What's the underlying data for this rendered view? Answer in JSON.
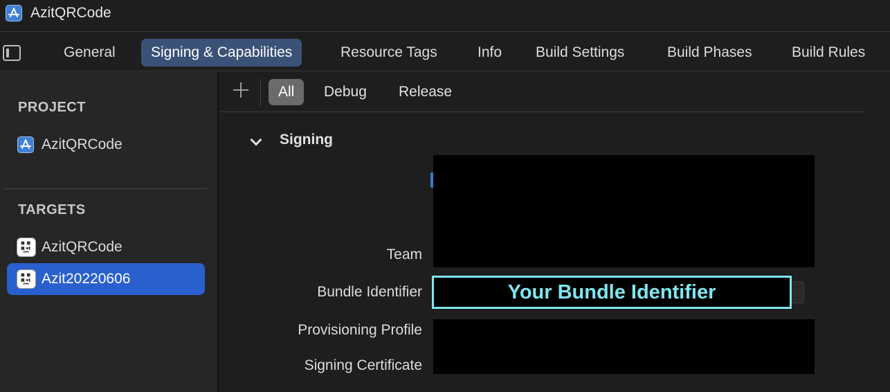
{
  "window": {
    "title": "AzitQRCode",
    "app_icon": "app-store-icon"
  },
  "tabs": [
    {
      "label": "General"
    },
    {
      "label": "Signing & Capabilities",
      "active": true
    },
    {
      "label": "Resource Tags"
    },
    {
      "label": "Info"
    },
    {
      "label": "Build Settings"
    },
    {
      "label": "Build Phases"
    },
    {
      "label": "Build Rules"
    }
  ],
  "sidebar": {
    "project_header": "PROJECT",
    "project_item": "AzitQRCode",
    "targets_header": "TARGETS",
    "targets": [
      {
        "label": "AzitQRCode",
        "selected": false
      },
      {
        "label": "Azit20220606",
        "selected": true
      }
    ]
  },
  "filters": {
    "all": "All",
    "debug": "Debug",
    "release": "Release",
    "active": "All"
  },
  "signing": {
    "section_label": "Signing",
    "team_label": "Team",
    "bundle_label": "Bundle Identifier",
    "bundle_value": "Your Bundle Identifier",
    "profile_label": "Provisioning Profile",
    "certificate_label": "Signing Certificate"
  },
  "colors": {
    "accent": "#2a5fce",
    "active_tab": "#3b5278",
    "highlight": "#7fe6f0"
  }
}
